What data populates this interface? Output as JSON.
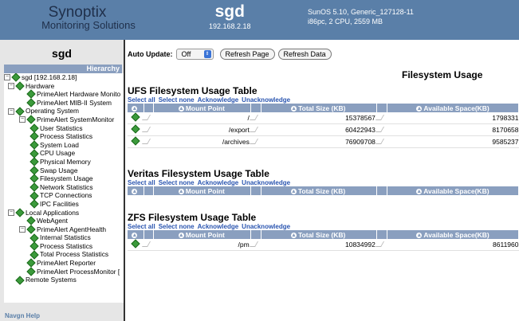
{
  "header": {
    "brand_line1": "Synoptix",
    "brand_line2": "Monitoring Solutions",
    "host": "sgd",
    "ip": "192.168.2.18",
    "sys_line1": "SunOS 5.10, Generic_127128-11",
    "sys_line2": "i86pc, 2 CPU, 2559 MB"
  },
  "sidebar": {
    "title": "sgd",
    "hierarchy_label": "Hierarchy",
    "footer": "Navgn Help",
    "tree": [
      {
        "label": "sgd [192.168.2.18]",
        "level": 0,
        "pm": "−"
      },
      {
        "label": "Hardware",
        "level": 1,
        "pm": "−"
      },
      {
        "label": "PrimeAlert Hardware Monito",
        "level": 2,
        "pm": ""
      },
      {
        "label": "PrimeAlert MIB-II System",
        "level": 2,
        "pm": ""
      },
      {
        "label": "Operating System",
        "level": 1,
        "pm": "−"
      },
      {
        "label": "PrimeAlert SystemMonitor",
        "level": 2,
        "pm": "−"
      },
      {
        "label": "User Statistics",
        "level": 3,
        "pm": ""
      },
      {
        "label": "Process Statistics",
        "level": 3,
        "pm": ""
      },
      {
        "label": "System Load",
        "level": 3,
        "pm": ""
      },
      {
        "label": "CPU Usage",
        "level": 3,
        "pm": ""
      },
      {
        "label": "Physical Memory",
        "level": 3,
        "pm": ""
      },
      {
        "label": "Swap Usage",
        "level": 3,
        "pm": ""
      },
      {
        "label": "Filesystem Usage",
        "level": 3,
        "pm": ""
      },
      {
        "label": "Network Statistics",
        "level": 3,
        "pm": ""
      },
      {
        "label": "TCP Connections",
        "level": 3,
        "pm": ""
      },
      {
        "label": "IPC Facilities",
        "level": 3,
        "pm": ""
      },
      {
        "label": "Local Applications",
        "level": 1,
        "pm": "−"
      },
      {
        "label": "WebAgent",
        "level": 2,
        "pm": ""
      },
      {
        "label": "PrimeAlert AgentHealth",
        "level": 2,
        "pm": "−"
      },
      {
        "label": "Internal Statistics",
        "level": 3,
        "pm": ""
      },
      {
        "label": "Process Statistics",
        "level": 3,
        "pm": ""
      },
      {
        "label": "Total Process Statistics",
        "level": 3,
        "pm": ""
      },
      {
        "label": "PrimeAlert Reporter",
        "level": 2,
        "pm": ""
      },
      {
        "label": "PrimeAlert ProcessMonitor [",
        "level": 2,
        "pm": ""
      },
      {
        "label": "Remote Systems",
        "level": 1,
        "pm": ""
      }
    ]
  },
  "toolbar": {
    "auto_update_label": "Auto Update:",
    "auto_update_value": "Off",
    "refresh_page": "Refresh Page",
    "refresh_data": "Refresh Data"
  },
  "main": {
    "page_title": "Filesystem Usage",
    "links": [
      "Select all",
      "Select none",
      "Acknowledge",
      "Unacknowledge"
    ],
    "columns": [
      "Mount Point",
      "Total Size (KB)",
      "Available Space(KB)"
    ],
    "sections": [
      {
        "title": "UFS Filesystem Usage Table",
        "rows": [
          {
            "mount": "/",
            "total": "15378567",
            "avail": "1798331"
          },
          {
            "mount": "/export",
            "total": "60422943",
            "avail": "8170658"
          },
          {
            "mount": "/archives",
            "total": "76909708",
            "avail": "9585237"
          }
        ]
      },
      {
        "title": "Veritas Filesystem Usage Table",
        "rows": []
      },
      {
        "title": "ZFS Filesystem Usage Table",
        "rows": [
          {
            "mount": "/pm",
            "total": "10834992",
            "avail": "8611960"
          }
        ]
      }
    ]
  }
}
